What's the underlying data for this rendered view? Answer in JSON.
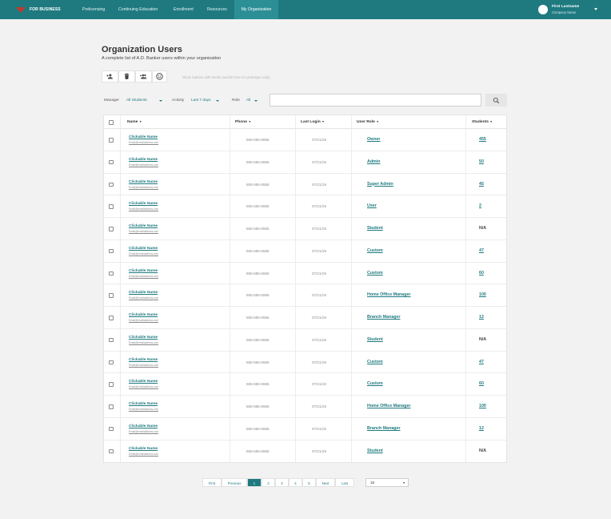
{
  "nav": {
    "brand": "FOR BUSINESS",
    "links": [
      "Prelicensing",
      "Continuing Education",
      "Enrollment",
      "Resources",
      "My Organization"
    ],
    "active_link": "My Organization",
    "user": {
      "name": "First Lastname",
      "company": "Company Name"
    }
  },
  "header": {
    "title": "Organization Users",
    "subtitle": "A complete list of A.D. Banker users within your organization"
  },
  "toolbar": {
    "icons": [
      "add-user-icon",
      "trash-icon",
      "add-group-icon",
      "emoji-icon"
    ],
    "hint": "Show buttons with words (words here for prototype only)"
  },
  "filters": {
    "manager_label": "Manager",
    "manager_value": "All Students",
    "activity_label": "Activity",
    "activity_value": "Last 7 days",
    "role_label": "Role",
    "role_value": "All",
    "search_placeholder": ""
  },
  "table": {
    "headers": {
      "name": "Name",
      "phone": "Phone",
      "last_login": "Last Login",
      "user_role": "User Role",
      "students": "Students"
    },
    "sort_indicator": "▼",
    "rows": [
      {
        "name": "Clickable Name",
        "email": "Email@emailaddress.com",
        "phone": "555-555-5555",
        "last_login": "07/21/19",
        "role": "Owner",
        "students": "455"
      },
      {
        "name": "Clickable Name",
        "email": "Email@emailaddress.com",
        "phone": "555-555-5555",
        "last_login": "07/21/19",
        "role": "Admin",
        "students": "50"
      },
      {
        "name": "Clickable Name",
        "email": "Email@emailaddress.com",
        "phone": "555-555-5555",
        "last_login": "07/21/19",
        "role": "Super Admin",
        "students": "45"
      },
      {
        "name": "Clickable Name",
        "email": "Email@emailaddress.com",
        "phone": "555-555-5555",
        "last_login": "07/21/19",
        "role": "User",
        "students": "2"
      },
      {
        "name": "Clickable Name",
        "email": "Email@emailaddress.com",
        "phone": "555-555-5555",
        "last_login": "07/21/19",
        "role": "Student",
        "students": "N/A"
      },
      {
        "name": "Clickable Name",
        "email": "Email@emailaddress.com",
        "phone": "555-555-5555",
        "last_login": "07/21/19",
        "role": "Custom",
        "students": "47"
      },
      {
        "name": "Clickable Name",
        "email": "Email@emailaddress.com",
        "phone": "555-555-5555",
        "last_login": "07/21/19",
        "role": "Custom",
        "students": "60"
      },
      {
        "name": "Clickable Name",
        "email": "Email@emailaddress.com",
        "phone": "555-555-5555",
        "last_login": "07/21/19",
        "role": "Home Office Manager",
        "students": "100"
      },
      {
        "name": "Clickable Name",
        "email": "Email@emailaddress.com",
        "phone": "555-555-5555",
        "last_login": "07/21/19",
        "role": "Branch Manager",
        "students": "12"
      },
      {
        "name": "Clickable Name",
        "email": "Email@emailaddress.com",
        "phone": "555-555-5555",
        "last_login": "07/21/19",
        "role": "Student",
        "students": "N/A"
      },
      {
        "name": "Clickable Name",
        "email": "Email@emailaddress.com",
        "phone": "555-555-5555",
        "last_login": "07/21/19",
        "role": "Custom",
        "students": "47"
      },
      {
        "name": "Clickable Name",
        "email": "Email@emailaddress.com",
        "phone": "555-555-5555",
        "last_login": "07/21/19",
        "role": "Custom",
        "students": "60"
      },
      {
        "name": "Clickable Name",
        "email": "Email@emailaddress.com",
        "phone": "555-555-5555",
        "last_login": "07/21/19",
        "role": "Home Office Manager",
        "students": "100"
      },
      {
        "name": "Clickable Name",
        "email": "Email@emailaddress.com",
        "phone": "555-555-5555",
        "last_login": "07/21/19",
        "role": "Branch Manager",
        "students": "12"
      },
      {
        "name": "Clickable Name",
        "email": "Email@emailaddress.com",
        "phone": "555-555-5555",
        "last_login": "07/21/19",
        "role": "Student",
        "students": "N/A"
      }
    ]
  },
  "pagination": {
    "first": "First",
    "previous": "Previous",
    "pages": [
      "1",
      "2",
      "3",
      "4",
      "5"
    ],
    "current_page": "1",
    "next": "Next",
    "last": "Last",
    "page_size": "15"
  },
  "colors": {
    "brand": "#1f7a80",
    "logo_red": "#c0392b"
  }
}
